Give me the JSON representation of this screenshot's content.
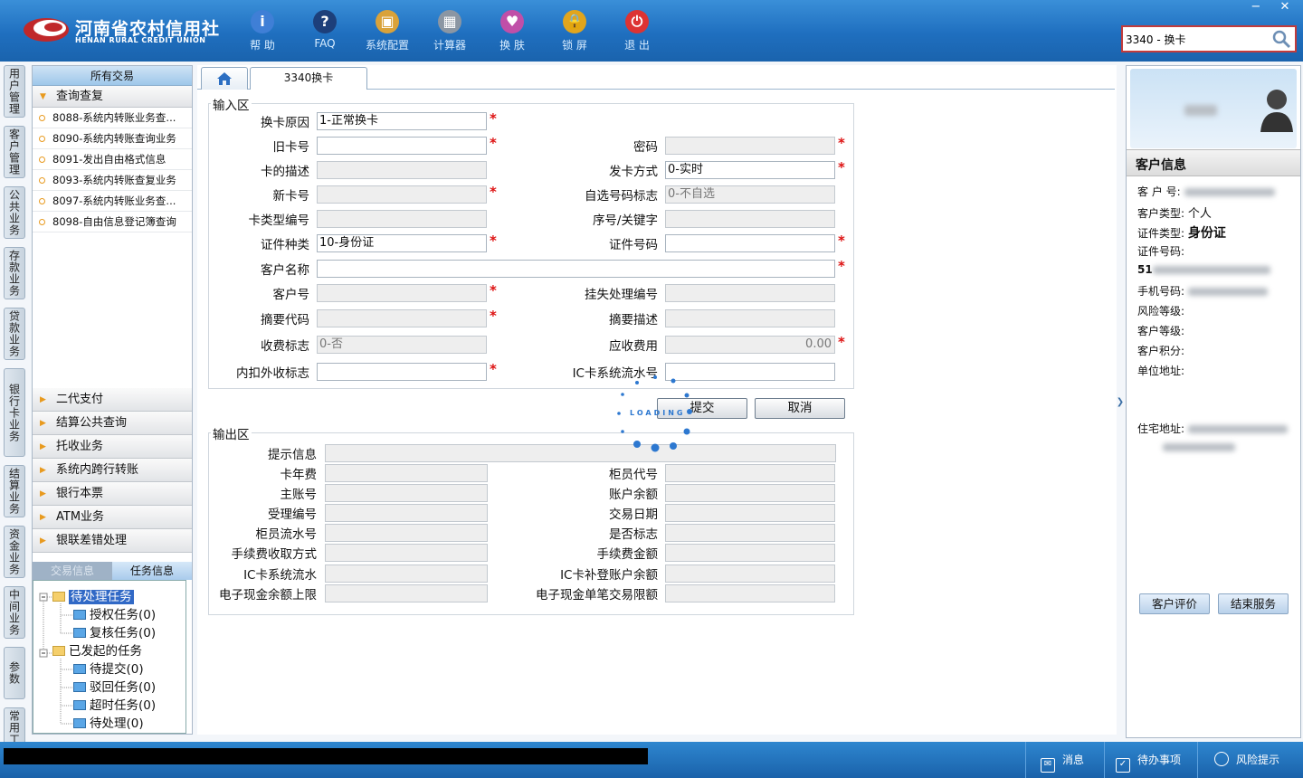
{
  "header": {
    "logo_cn": "河南省农村信用社",
    "logo_en": "HENAN RURAL CREDIT UNION",
    "tools": [
      {
        "label": "帮 助",
        "icon": "info-icon",
        "color": "#3f7fd6"
      },
      {
        "label": "FAQ",
        "icon": "question-icon",
        "color": "#1d3f7a"
      },
      {
        "label": "系统配置",
        "icon": "toolbox-icon",
        "color": "#d9a23a"
      },
      {
        "label": "计算器",
        "icon": "calculator-icon",
        "color": "#8b96a3"
      },
      {
        "label": "换 肤",
        "icon": "shirt-icon",
        "color": "#c04fa8"
      },
      {
        "label": "锁 屏",
        "icon": "lock-icon",
        "color": "#e1a51d"
      },
      {
        "label": "退 出",
        "icon": "power-icon",
        "color": "#d33"
      }
    ],
    "window_controls": [
      "−",
      "✕"
    ],
    "search_value": "3340 - 换卡"
  },
  "left_tabs": [
    "用户管理",
    "客户管理",
    "公共业务",
    "存款业务",
    "贷款业务",
    "银行卡业务",
    "结算业务",
    "资金业务",
    "中间业务",
    "参数",
    "常用工具"
  ],
  "nav": {
    "header": "所有交易",
    "open_group": "查询查复",
    "items": [
      "8088-系统内转账业务查...",
      "8090-系统内转账查询业务",
      "8091-发出自由格式信息",
      "8093-系统内转账查复业务",
      "8097-系统内转账业务查...",
      "8098-自由信息登记簿查询"
    ],
    "groups": [
      "二代支付",
      "结算公共查询",
      "托收业务",
      "系统内跨行转账",
      "银行本票",
      "ATM业务",
      "银联差错处理"
    ],
    "task_tabs": [
      "交易信息",
      "任务信息"
    ],
    "tree": {
      "pending": "待处理任务",
      "pending_children": [
        "授权任务(0)",
        "复核任务(0)"
      ],
      "initiated": "已发起的任务",
      "initiated_children": [
        "待提交(0)",
        "驳回任务(0)",
        "超时任务(0)",
        "待处理(0)"
      ]
    }
  },
  "tabs": {
    "home": "home",
    "active": "3340换卡"
  },
  "input_area": {
    "title": "输入区",
    "fields": {
      "reason_label": "换卡原因",
      "reason_value": "1-正常换卡",
      "old_card_label": "旧卡号",
      "old_card_value": "",
      "password_label": "密码",
      "card_desc_label": "卡的描述",
      "issue_mode_label": "发卡方式",
      "issue_mode_value": "0-实时",
      "new_card_label": "新卡号",
      "choose_no_label": "自选号码标志",
      "choose_no_value": "0-不自选",
      "card_type_label": "卡类型编号",
      "seq_key_label": "序号/关键字",
      "id_type_label": "证件种类",
      "id_type_value": "10-身份证",
      "id_no_label": "证件号码",
      "cust_name_label": "客户名称",
      "cust_no_label": "客户号",
      "loss_no_label": "挂失处理编号",
      "summary_code_label": "摘要代码",
      "summary_desc_label": "摘要描述",
      "fee_flag_label": "收费标志",
      "fee_flag_value": "0-否",
      "fee_due_label": "应收费用",
      "fee_due_value": "0.00",
      "inout_label": "内扣外收标志",
      "ic_serial_label": "IC卡系统流水号"
    },
    "submit": "提交",
    "cancel": "取消",
    "loading": "LOADING"
  },
  "output_area": {
    "title": "输出区",
    "prompt_label": "提示信息",
    "card_fee_label": "卡年费",
    "teller_code_label": "柜员代号",
    "main_acct_label": "主账号",
    "acct_balance_label": "账户余额",
    "accept_no_label": "受理编号",
    "trade_date_label": "交易日期",
    "teller_serial_label": "柜员流水号",
    "yes_no_label": "是否标志",
    "fee_mode_label": "手续费收取方式",
    "fee_amount_label": "手续费金额",
    "ic_serial_label": "IC卡系统流水",
    "ic_balance_label": "IC卡补登账户余额",
    "ecash_limit_label": "电子现金余额上限",
    "ecash_single_label": "电子现金单笔交易限额"
  },
  "customer": {
    "title": "客户信息",
    "cust_no_label": "客 户 号:",
    "cust_type_label": "客户类型:",
    "cust_type_value": "个人",
    "id_type_label": "证件类型:",
    "id_type_value": "身份证",
    "id_no_label": "证件号码:",
    "id_no_prefix": "51",
    "phone_label": "手机号码:",
    "risk_label": "风险等级:",
    "level_label": "客户等级:",
    "points_label": "客户积分:",
    "company_label": "单位地址:",
    "home_label": "住宅地址:",
    "rate_button": "客户评价",
    "end_button": "结束服务"
  },
  "statusbar": {
    "message": "消息",
    "todo": "待办事项",
    "risk": "风险提示"
  }
}
